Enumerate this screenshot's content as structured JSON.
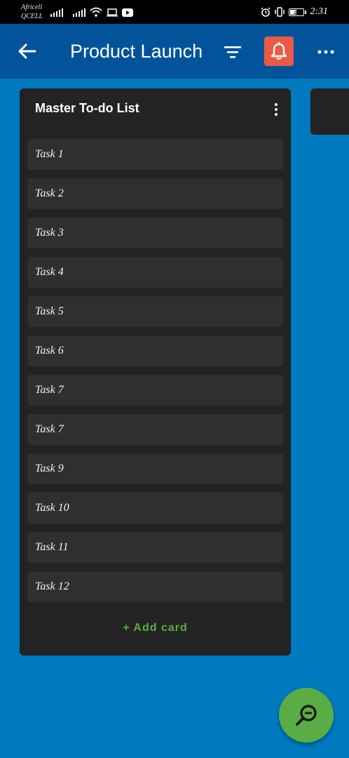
{
  "status_bar": {
    "carrier_line1": "Africell",
    "carrier_line2": "QCELL",
    "battery": "45",
    "time": "2:31"
  },
  "app_bar": {
    "title": "Product Launch",
    "back_icon": "arrow-left-icon",
    "filter_icon": "filter-icon",
    "notification_icon": "bell-icon",
    "more_icon": "more-horizontal-icon",
    "accent_color": "#eb5a46",
    "background": "#03539b"
  },
  "board": {
    "background": "#0079bf",
    "list": {
      "title": "Master To-do List",
      "cards": [
        "Task 1",
        "Task 2",
        "Task 3",
        "Task 4",
        "Task 5",
        "Task 6",
        "Task 7",
        "Task 7",
        "Task 9",
        "Task 10",
        "Task 11",
        "Task 12"
      ],
      "add_card_label": "+ Add card"
    }
  },
  "fab": {
    "icon": "zoom-out-icon",
    "color": "#5aac44"
  }
}
